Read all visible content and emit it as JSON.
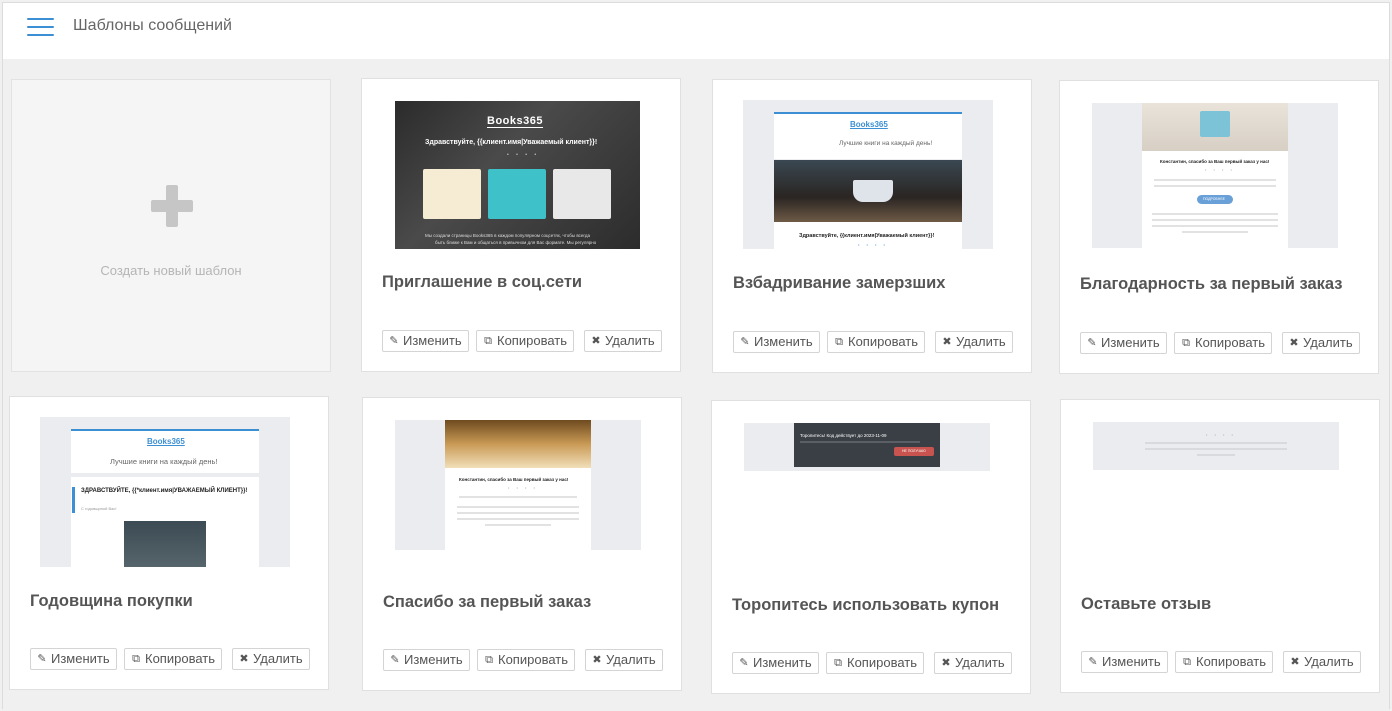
{
  "header": {
    "menu_icon": "hamburger-icon",
    "title": "Шаблоны сообщений"
  },
  "colors": {
    "accent": "#3d8fd4",
    "background": "#f0f0f0",
    "card_border": "#e0e0e0"
  },
  "new_template": {
    "icon": "plus-icon",
    "label": "Создать новый шаблон"
  },
  "buttons": {
    "edit": "Изменить",
    "copy": "Копировать",
    "delete": "Удалить",
    "edit_icon": "pencil-icon",
    "copy_icon": "copy-icon",
    "delete_icon": "close-icon"
  },
  "templates": [
    {
      "title": "Приглашение в соц.сети",
      "preview": {
        "logo": "Books365",
        "greeting": "Здравствуйте, {{клиент.имя|Уважаемый клиент}}!",
        "dots": "• • • •",
        "footer": "Мы создали страницы Books365 в каждом популярном соцсетях, чтобы всегда",
        "footer2": "быть ближе к Вам и общаться в привычном для Вас формате. Мы регулярно"
      }
    },
    {
      "title": "Взбадривание замерзших",
      "preview": {
        "logo": "Books365",
        "tagline": "Лучшие книги на каждый день!",
        "greeting": "Здравствуйте, {{клиент.имя|Уважаемый клиент}}!",
        "dots": "• • • •"
      }
    },
    {
      "title": "Благодарность за первый заказ",
      "preview": {
        "heading": "Константин, спасибо за Ваш первый заказ у нас!",
        "dots": "• • • •",
        "cta": "ПОДРОБНЕЕ"
      }
    },
    {
      "title": "Годовщина покупки",
      "preview": {
        "logo": "Books365",
        "tagline": "Лучшие книги на каждый день!",
        "heading": "ЗДРАВСТВУЙТЕ, {{*клиент.имя|УВАЖАЕМЫЙ КЛИЕНТ}}!",
        "subtext": "С годовщиной Вас!"
      }
    },
    {
      "title": "Спасибо за первый заказ",
      "preview": {
        "heading": "Константин, спасибо за Ваш первый заказ у нас!",
        "dots": "• • • •"
      }
    },
    {
      "title": "Торопитесь использовать купон",
      "preview": {
        "heading": "Торопитесь! Код действует до 2023-11-09",
        "cta": "НЕ ПОЛУЧАЮ"
      }
    },
    {
      "title": "Оставьте отзыв",
      "preview": {
        "dots": "• • • •"
      }
    }
  ]
}
